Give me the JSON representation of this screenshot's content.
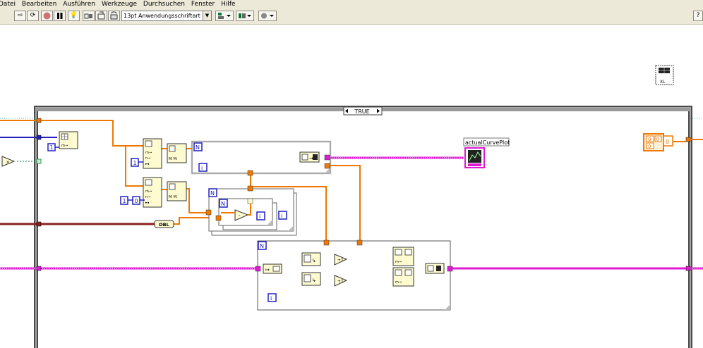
{
  "menu": {
    "items": [
      {
        "label": "Datei"
      },
      {
        "label": "Bearbeiten"
      },
      {
        "label": "Ausführen"
      },
      {
        "label": "Werkzeuge"
      },
      {
        "label": "Durchsuchen"
      },
      {
        "label": "Fenster"
      },
      {
        "label": "Hilfe"
      }
    ]
  },
  "toolbar": {
    "font_select_value": "13pt Anwendungsschriftart",
    "help_label": "?"
  },
  "diagram": {
    "case_selector_value": "TRUE",
    "graph_label": "actualCurvePlot",
    "dbl_label": "DBL",
    "loop_count_label": "N",
    "loop_index_label": "i",
    "const_one": "1",
    "const_zero": "0",
    "const_zero_b": "0",
    "xl_label": "XL",
    "wire_colors": {
      "numeric": "#f07800",
      "waveform": "#e01ad4",
      "double": "#8c1e1e",
      "integer": "#2020c0",
      "boolean": "#0a7a3c"
    }
  }
}
